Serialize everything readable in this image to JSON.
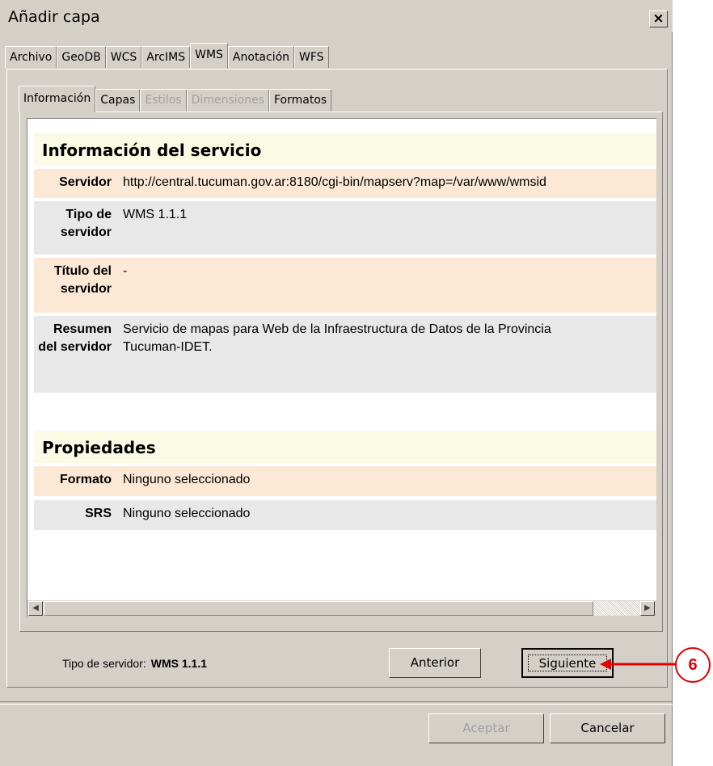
{
  "window": {
    "title": "Añadir capa",
    "close_label": "×"
  },
  "tabs": [
    {
      "label": "Archivo"
    },
    {
      "label": "GeoDB"
    },
    {
      "label": "WCS"
    },
    {
      "label": "ArcIMS"
    },
    {
      "label": "WMS"
    },
    {
      "label": "Anotación"
    },
    {
      "label": "WFS"
    }
  ],
  "active_tab": "WMS",
  "subtabs": [
    {
      "label": "Información"
    },
    {
      "label": "Capas"
    },
    {
      "label": "Estilos"
    },
    {
      "label": "Dimensiones"
    },
    {
      "label": "Formatos"
    }
  ],
  "info": {
    "service_heading": "Información del servicio",
    "rows": [
      {
        "label": "Servidor",
        "value": "http://central.tucuman.gov.ar:8180/cgi-bin/mapserv?map=/var/www/wmsid"
      },
      {
        "label": "Tipo de servidor",
        "value": "WMS 1.1.1"
      },
      {
        "label": "Título del servidor",
        "value": "-"
      },
      {
        "label": "Resumen del servidor",
        "value_line1": "Servicio de mapas para Web de la Infraestructura de Datos de la Provincia",
        "value_line2": "Tucuman-IDET."
      }
    ],
    "properties_heading": "Propiedades",
    "properties": [
      {
        "label": "Formato",
        "value": "Ninguno seleccionado"
      },
      {
        "label": "SRS",
        "value": "Ninguno seleccionado"
      }
    ]
  },
  "status": {
    "label": "Tipo de servidor:",
    "value": "WMS 1.1.1"
  },
  "buttons": {
    "previous": "Anterior",
    "next": "Siguiente",
    "accept": "Aceptar",
    "cancel": "Cancelar"
  },
  "annotation": {
    "number": "6",
    "color": "#e00000"
  }
}
